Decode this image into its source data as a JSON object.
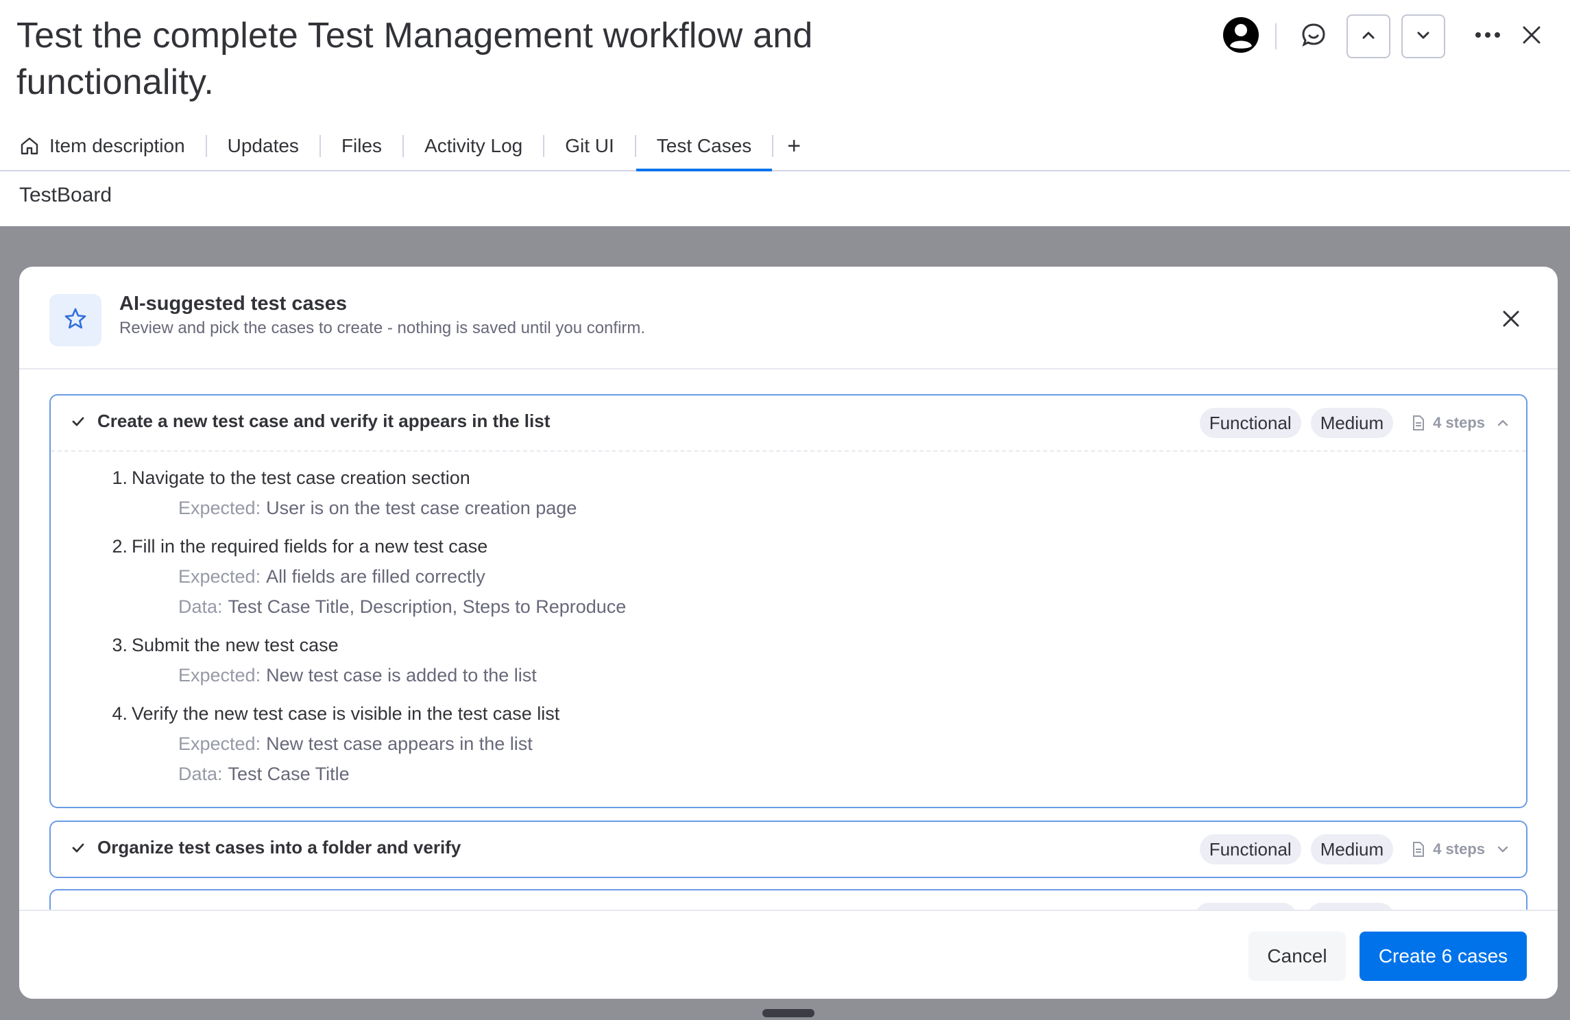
{
  "item": {
    "title": "Test the complete Test Management workflow and functionality."
  },
  "tabs": [
    {
      "label": "Item description",
      "icon": "home-icon"
    },
    {
      "label": "Updates"
    },
    {
      "label": "Files"
    },
    {
      "label": "Activity Log"
    },
    {
      "label": "Git UI"
    },
    {
      "label": "Test Cases",
      "active": true
    },
    {
      "label": "+"
    }
  ],
  "board": {
    "name": "TestBoard"
  },
  "modal": {
    "title": "AI-suggested test cases",
    "subtitle": "Review and pick the cases to create - nothing is saved until you confirm.",
    "cases": [
      {
        "title": "Create a new test case and verify it appears in the list",
        "type": "Functional",
        "priority": "Medium",
        "steps_count": "4 steps",
        "expanded": true,
        "steps": [
          {
            "num": "1.",
            "action": "Navigate to the test case creation section",
            "expected": "User is on the test case creation page"
          },
          {
            "num": "2.",
            "action": "Fill in the required fields for a new test case",
            "expected": "All fields are filled correctly",
            "data": "Test Case Title, Description, Steps to Reproduce"
          },
          {
            "num": "3.",
            "action": "Submit the new test case",
            "expected": "New test case is added to the list"
          },
          {
            "num": "4.",
            "action": "Verify the new test case is visible in the test case list",
            "expected": "New test case appears in the list",
            "data": "Test Case Title"
          }
        ]
      },
      {
        "title": "Organize test cases into a folder and verify",
        "type": "Functional",
        "priority": "Medium",
        "steps_count": "4 steps",
        "expanded": false
      }
    ],
    "labels": {
      "expected": "Expected:",
      "data": "Data:"
    },
    "cancel_label": "Cancel",
    "create_label": "Create 6 cases"
  },
  "colors": {
    "accent": "#0073ea",
    "card_border": "#6a9be6",
    "overlay": "#8f9096"
  }
}
